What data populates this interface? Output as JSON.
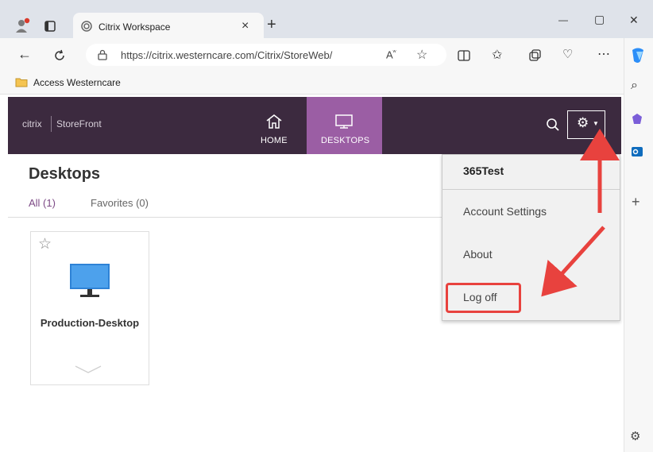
{
  "browser": {
    "tab_title": "Citrix Workspace",
    "tab_close": "×",
    "new_tab": "+",
    "url": "https://citrix.westerncare.com/Citrix/StoreWeb/",
    "favorites_bar": [
      {
        "label": "Access Westerncare"
      }
    ],
    "window_controls": {
      "minimize": "—",
      "maximize": "▢",
      "close": "✕"
    }
  },
  "storefront": {
    "brand": "citrix",
    "product": "StoreFront",
    "nav": [
      {
        "label": "HOME",
        "active": false
      },
      {
        "label": "DESKTOPS",
        "active": true
      }
    ],
    "page_title": "Desktops",
    "filters": [
      {
        "label": "All (1)",
        "active": true
      },
      {
        "label": "Favorites (0)",
        "active": false
      }
    ],
    "desktops": [
      {
        "name": "Production-Desktop",
        "favorite": false
      }
    ],
    "user_menu": {
      "username": "365Test",
      "items": [
        {
          "label": "Account Settings"
        },
        {
          "label": "About"
        },
        {
          "label": "Log off",
          "highlighted": true
        }
      ]
    }
  },
  "colors": {
    "header_bg": "#3c2a3f",
    "active_tab": "#9b5ea4",
    "accent_text": "#7d4a86",
    "annotation_red": "#e8423e"
  }
}
